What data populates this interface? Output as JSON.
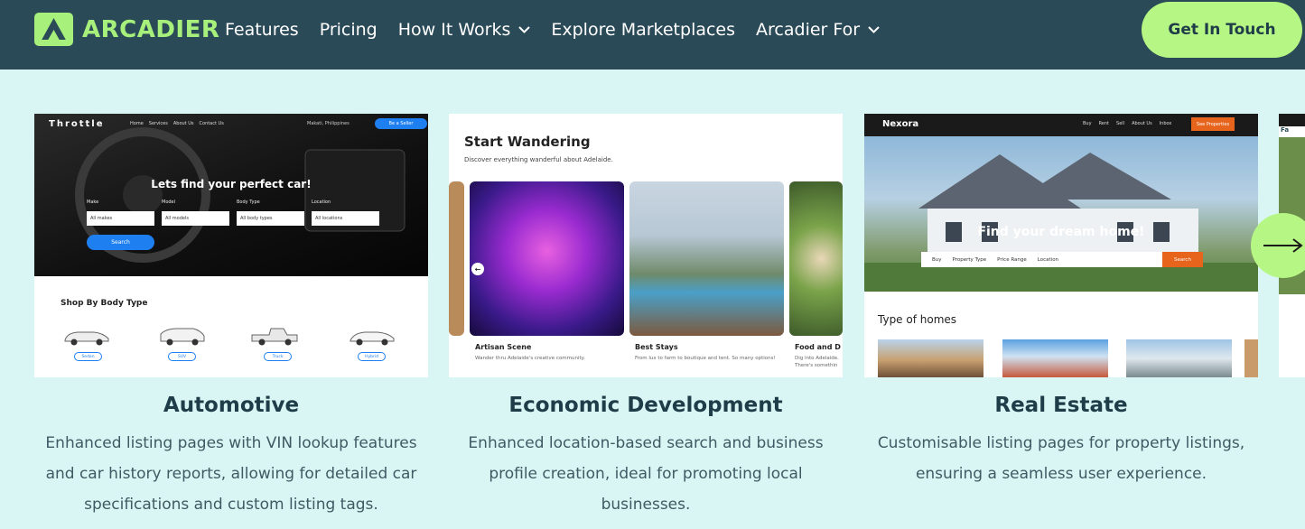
{
  "header": {
    "logo_text": "ARCADIER",
    "nav": [
      {
        "label": "Features"
      },
      {
        "label": "Pricing"
      },
      {
        "label": "How It Works"
      },
      {
        "label": "Explore Marketplaces"
      },
      {
        "label": "Arcadier For"
      }
    ],
    "cta_label": "Get In Touch"
  },
  "cards": [
    {
      "title": "Automotive",
      "description": "Enhanced listing pages with VIN lookup features and car history reports, allowing for detailed car specifications and custom listing tags.",
      "thumb": {
        "brand": "Throttle",
        "nav": [
          "Home",
          "Services",
          "About Us",
          "Contact Us"
        ],
        "location": "Makati, Philippines",
        "seller_btn": "Be a Seller",
        "headline": "Lets find your perfect car!",
        "fields": [
          {
            "label": "Make",
            "value": "All makes"
          },
          {
            "label": "Model",
            "value": "All models"
          },
          {
            "label": "Body Type",
            "value": "All body types"
          },
          {
            "label": "Location",
            "value": "All locations"
          }
        ],
        "search_btn": "Search",
        "shop_heading": "Shop By Body Type",
        "body_types": [
          "Sedan",
          "SUV",
          "Truck",
          "Hybrid"
        ]
      }
    },
    {
      "title": "Economic Development",
      "description": "Enhanced location-based search and business profile creation, ideal for promoting local businesses.",
      "thumb": {
        "heading": "Start Wandering",
        "subheading": "Discover everything wanderful about Adelaide.",
        "items": [
          {
            "title": "Artisan Scene",
            "sub": "Wander thru Adelaide's creative community."
          },
          {
            "title": "Best Stays",
            "sub": "From lux to farm to boutique and tent. So many options!"
          },
          {
            "title": "Food and D",
            "sub": "Dig into Adelaide. There's somethin"
          }
        ]
      }
    },
    {
      "title": "Real Estate",
      "description": "Customisable listing pages for property listings, ensuring a seamless user experience.",
      "thumb": {
        "brand": "Nexora",
        "nav": [
          "Buy",
          "Rent",
          "Sell",
          "About Us",
          "Inbox"
        ],
        "cta": "See Properties",
        "headline": "Find your dream home!",
        "filters": [
          "Buy",
          "Property Type",
          "Price Range",
          "Location"
        ],
        "search_btn": "Search",
        "types_heading": "Type of homes"
      }
    }
  ],
  "peek_card": {
    "label": "Fa"
  },
  "colors": {
    "header_bg": "#2b4a57",
    "accent": "#b6f684",
    "page_bg": "#d9f6f4",
    "logo": "#a6f07b"
  }
}
